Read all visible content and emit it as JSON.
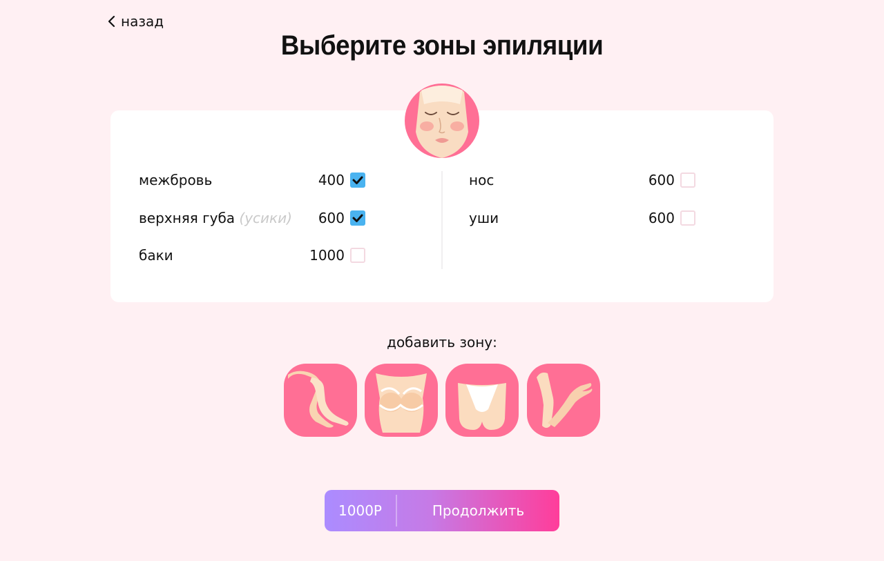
{
  "nav": {
    "back_label": "назад"
  },
  "page": {
    "title": "Выберите зоны эпиляции"
  },
  "zones_left": [
    {
      "label": "межбровь",
      "hint": "",
      "price": "400",
      "checked": true
    },
    {
      "label": "верхняя губа",
      "hint": "(усики)",
      "price": "600",
      "checked": true
    },
    {
      "label": "баки",
      "hint": "",
      "price": "1000",
      "checked": false
    }
  ],
  "zones_right": [
    {
      "label": "нос",
      "hint": "",
      "price": "600",
      "checked": false
    },
    {
      "label": "уши",
      "hint": "",
      "price": "600",
      "checked": false
    }
  ],
  "add_zone": {
    "label": "добавить зону:",
    "items": [
      {
        "icon": "legs-icon"
      },
      {
        "icon": "chest-icon"
      },
      {
        "icon": "bikini-icon"
      },
      {
        "icon": "arm-icon"
      }
    ]
  },
  "cta": {
    "amount": "1000Р",
    "label": "Продолжить"
  },
  "colors": {
    "background": "#fff0f3",
    "accent_pink": "#ff6f95",
    "checkbox_on": "#4ab3f0",
    "gradient_start": "#ab8cff",
    "gradient_end": "#ff3d9a"
  }
}
